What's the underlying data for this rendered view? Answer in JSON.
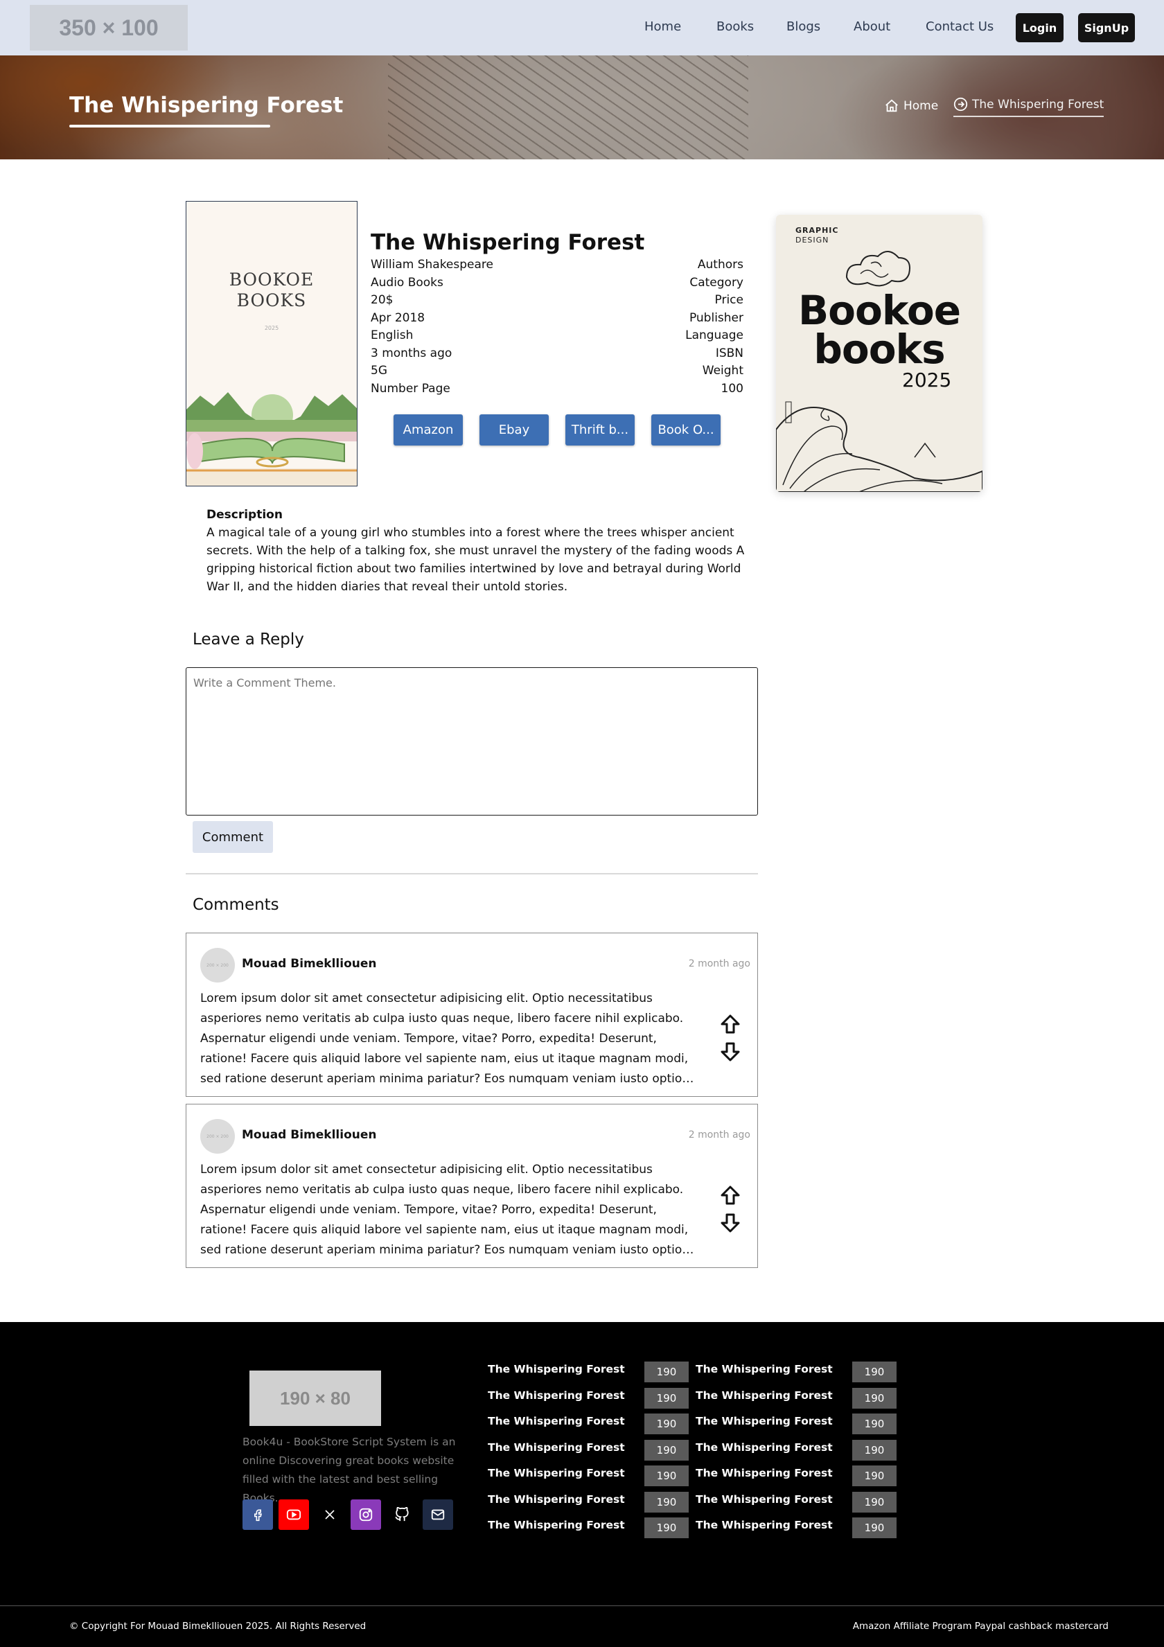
{
  "header": {
    "logo_text": "350 × 100",
    "nav": [
      "Home",
      "Books",
      "Blogs",
      "About",
      "Contact Us"
    ],
    "login": "Login",
    "signup": "SignUp"
  },
  "hero": {
    "title": "The Whispering Forest",
    "breadcrumb_home": "Home",
    "breadcrumb_current": "The Whispering Forest"
  },
  "book": {
    "cover_line1": "BOOKOE",
    "cover_line2": "BOOKS",
    "cover_year": "2025",
    "title": "The Whispering Forest",
    "info": [
      {
        "value": "William Shakespeare",
        "key": "Authors"
      },
      {
        "value": "Audio Books",
        "key": "Category"
      },
      {
        "value": "20$",
        "key": "Price"
      },
      {
        "value": "Apr 2018",
        "key": "Publisher"
      },
      {
        "value": "English",
        "key": "Language"
      },
      {
        "value": "3 months ago",
        "key": "ISBN"
      },
      {
        "value": "5G",
        "key": "Weight"
      },
      {
        "value": "Number Page",
        "key": "100"
      }
    ],
    "stores": [
      "Amazon",
      "Ebay",
      "Thrift b...",
      "Book O..."
    ]
  },
  "side_cover": {
    "label1": "GRAPHIC",
    "label2": "DESIGN",
    "title_line1": "Bookoe",
    "title_line2": "books",
    "year": "2025"
  },
  "description": {
    "title": "Description",
    "text": "A magical tale of a young girl who stumbles into a forest where the trees whisper ancient secrets. With the help of a talking fox, she must unravel the mystery of the fading woods A gripping historical fiction about two families intertwined by love and betrayal during World War II, and the hidden diaries that reveal their untold stories."
  },
  "reply": {
    "title": "Leave a Reply",
    "placeholder": "Write a Comment Theme.",
    "button": "Comment"
  },
  "comments": {
    "title": "Comments",
    "items": [
      {
        "avatar_text": "200 × 200",
        "author": "Mouad Bimeklliouen",
        "time": "2 month ago",
        "body": "Lorem ipsum dolor sit amet consectetur adipisicing elit. Optio necessitatibus asperiores nemo veritatis ab culpa iusto quas neque, libero facere nihil explicabo. Aspernatur eligendi unde veniam. Tempore, vitae? Porro, expedita! Deserunt, ratione! Facere quis aliquid labore vel sapiente nam, eius ut itaque magnam modi, sed ratione deserunt aperiam minima pariatur? Eos numquam veniam iusto optio ad..."
      },
      {
        "avatar_text": "200 × 200",
        "author": "Mouad Bimeklliouen",
        "time": "2 month ago",
        "body": "Lorem ipsum dolor sit amet consectetur adipisicing elit. Optio necessitatibus asperiores nemo veritatis ab culpa iusto quas neque, libero facere nihil explicabo. Aspernatur eligendi unde veniam. Tempore, vitae? Porro, expedita! Deserunt, ratione! Facere quis aliquid labore vel sapiente nam, eius ut itaque magnam modi, sed ratione deserunt aperiam minima pariatur? Eos numquam veniam iusto optio ad..."
      }
    ]
  },
  "footer": {
    "logo_text": "190 × 80",
    "about": "Book4u - BookStore Script System is an online Discovering great books website filled with the latest and best selling Books.",
    "social": [
      {
        "icon": "facebook-icon",
        "color": "#3b5998"
      },
      {
        "icon": "youtube-icon",
        "color": "#ff0000"
      },
      {
        "icon": "x-icon",
        "color": "#000000"
      },
      {
        "icon": "instagram-icon",
        "color": "#8a3ab9"
      },
      {
        "icon": "github-icon",
        "color": "#000000"
      },
      {
        "icon": "mail-icon",
        "color": "#1e2a44"
      }
    ],
    "links_col1": [
      {
        "title": "The Whispering Forest",
        "count": "190"
      },
      {
        "title": "The Whispering Forest",
        "count": "190"
      },
      {
        "title": "The Whispering Forest",
        "count": "190"
      },
      {
        "title": "The Whispering Forest",
        "count": "190"
      },
      {
        "title": "The Whispering Forest",
        "count": "190"
      },
      {
        "title": "The Whispering Forest",
        "count": "190"
      },
      {
        "title": "The Whispering Forest",
        "count": "190"
      }
    ],
    "links_col2": [
      {
        "title": "The Whispering Forest",
        "count": "190"
      },
      {
        "title": "The Whispering Forest",
        "count": "190"
      },
      {
        "title": "The Whispering Forest",
        "count": "190"
      },
      {
        "title": "The Whispering Forest",
        "count": "190"
      },
      {
        "title": "The Whispering Forest",
        "count": "190"
      },
      {
        "title": "The Whispering Forest",
        "count": "190"
      },
      {
        "title": "The Whispering Forest",
        "count": "190"
      }
    ],
    "copyright": "© Copyright For Mouad Bimeklliouen 2025. All Rights Reserved",
    "right_text": "Amazon Affiliate Program Paypal cashback mastercard"
  }
}
